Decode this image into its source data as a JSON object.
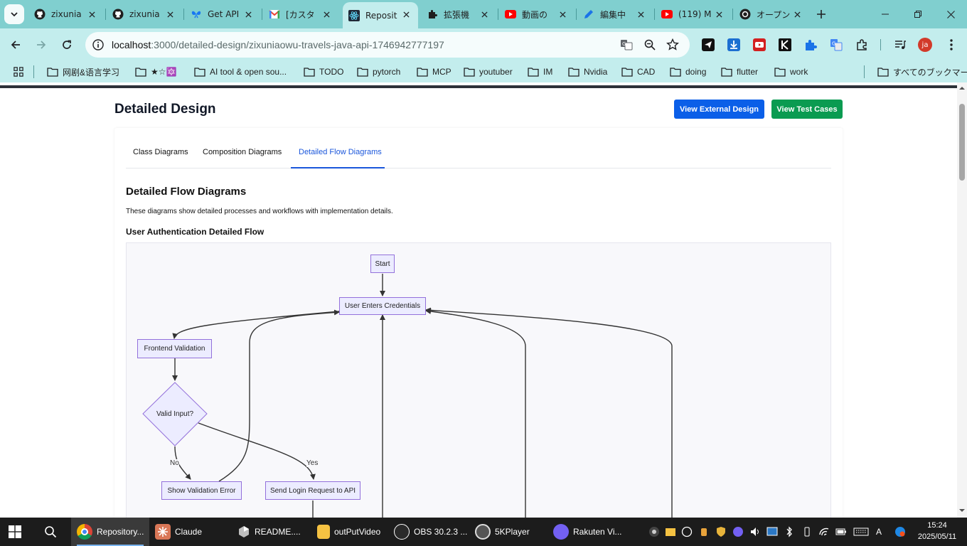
{
  "browser": {
    "tabs": [
      {
        "title": "zixunia",
        "icon": "github-icon"
      },
      {
        "title": "zixunia",
        "icon": "github-icon"
      },
      {
        "title": "Get API",
        "icon": "butterfly-icon"
      },
      {
        "title": "[カスタ",
        "icon": "gmail-icon"
      },
      {
        "title": "Reposit",
        "icon": "react-icon",
        "active": true
      },
      {
        "title": "拡張機",
        "icon": "puzzle-icon"
      },
      {
        "title": "動画の",
        "icon": "youtube-icon"
      },
      {
        "title": "編集中",
        "icon": "edit-icon"
      },
      {
        "title": "(119) M",
        "icon": "youtube-icon"
      },
      {
        "title": "オープン",
        "icon": "openai-icon"
      }
    ],
    "url_host": "localhost",
    "url_path": ":3000/detailed-design/zixuniaowu-travels-java-api-1746942777197",
    "profile_initials": "ja",
    "bookmarks": [
      "网剧&语言学习",
      "★☆🔯",
      "AI tool & open sou...",
      "TODO",
      "pytorch",
      "MCP",
      "youtuber",
      "IM",
      "Nvidia",
      "CAD",
      "doing",
      "flutter",
      "work"
    ],
    "all_bookmarks": "すべてのブックマーク"
  },
  "page": {
    "title": "Detailed Design",
    "btn_external": "View External Design",
    "btn_test": "View Test Cases",
    "tabs": [
      "Class Diagrams",
      "Composition Diagrams",
      "Detailed Flow Diagrams"
    ],
    "active_tab": "Detailed Flow Diagrams",
    "section_title": "Detailed Flow Diagrams",
    "section_desc": "These diagrams show detailed processes and workflows with implementation details.",
    "sub_title": "User Authentication Detailed Flow"
  },
  "diagram": {
    "nodes": {
      "start": "Start",
      "credentials": "User Enters Credentials",
      "frontend": "Frontend Validation",
      "valid": "Valid Input?",
      "error": "Show Validation Error",
      "send": "Send Login Request to API"
    },
    "edge_no": "No",
    "edge_yes": "Yes",
    "colors": {
      "node_fill": "#ececff",
      "node_stroke": "#9370db",
      "edge": "#333333"
    }
  },
  "taskbar": {
    "items": [
      {
        "label": "Repository...",
        "icon": "chrome-icon",
        "active": true
      },
      {
        "label": "Claude",
        "icon": "claude-icon"
      },
      {
        "label": "README....",
        "icon": "cursor-icon"
      },
      {
        "label": "outPutVideo",
        "icon": "folder-icon"
      },
      {
        "label": "OBS 30.2.3 ...",
        "icon": "obs-icon"
      },
      {
        "label": "5KPlayer",
        "icon": "5kplayer-icon"
      },
      {
        "label": "Rakuten Vi...",
        "icon": "viber-icon"
      }
    ],
    "ime": "A",
    "time": "15:24",
    "date": "2025/05/11"
  }
}
